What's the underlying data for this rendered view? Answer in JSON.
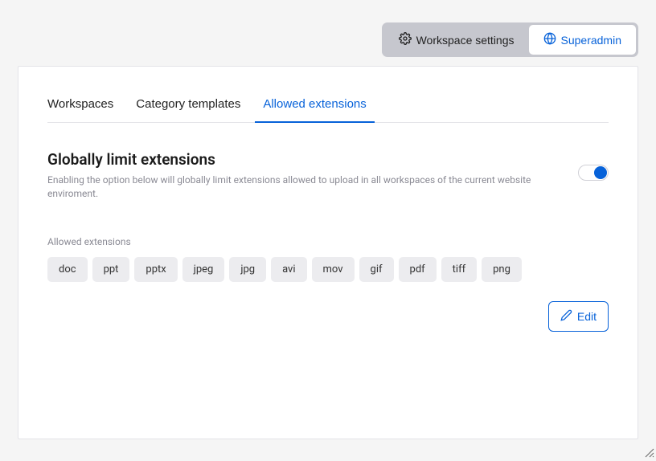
{
  "header": {
    "workspace_settings": "Workspace settings",
    "superadmin": "Superadmin"
  },
  "tabs": {
    "workspaces": "Workspaces",
    "category_templates": "Category templates",
    "allowed_extensions": "Allowed extensions"
  },
  "section": {
    "title": "Globally limit extensions",
    "description": "Enabling the option below will globally limit extensions allowed to upload in all workspaces of the current website enviroment.",
    "toggle_on": true
  },
  "extensions": {
    "label": "Allowed extensions",
    "items": [
      "doc",
      "ppt",
      "pptx",
      "jpeg",
      "jpg",
      "avi",
      "mov",
      "gif",
      "pdf",
      "tiff",
      "png"
    ]
  },
  "edit_label": "Edit"
}
